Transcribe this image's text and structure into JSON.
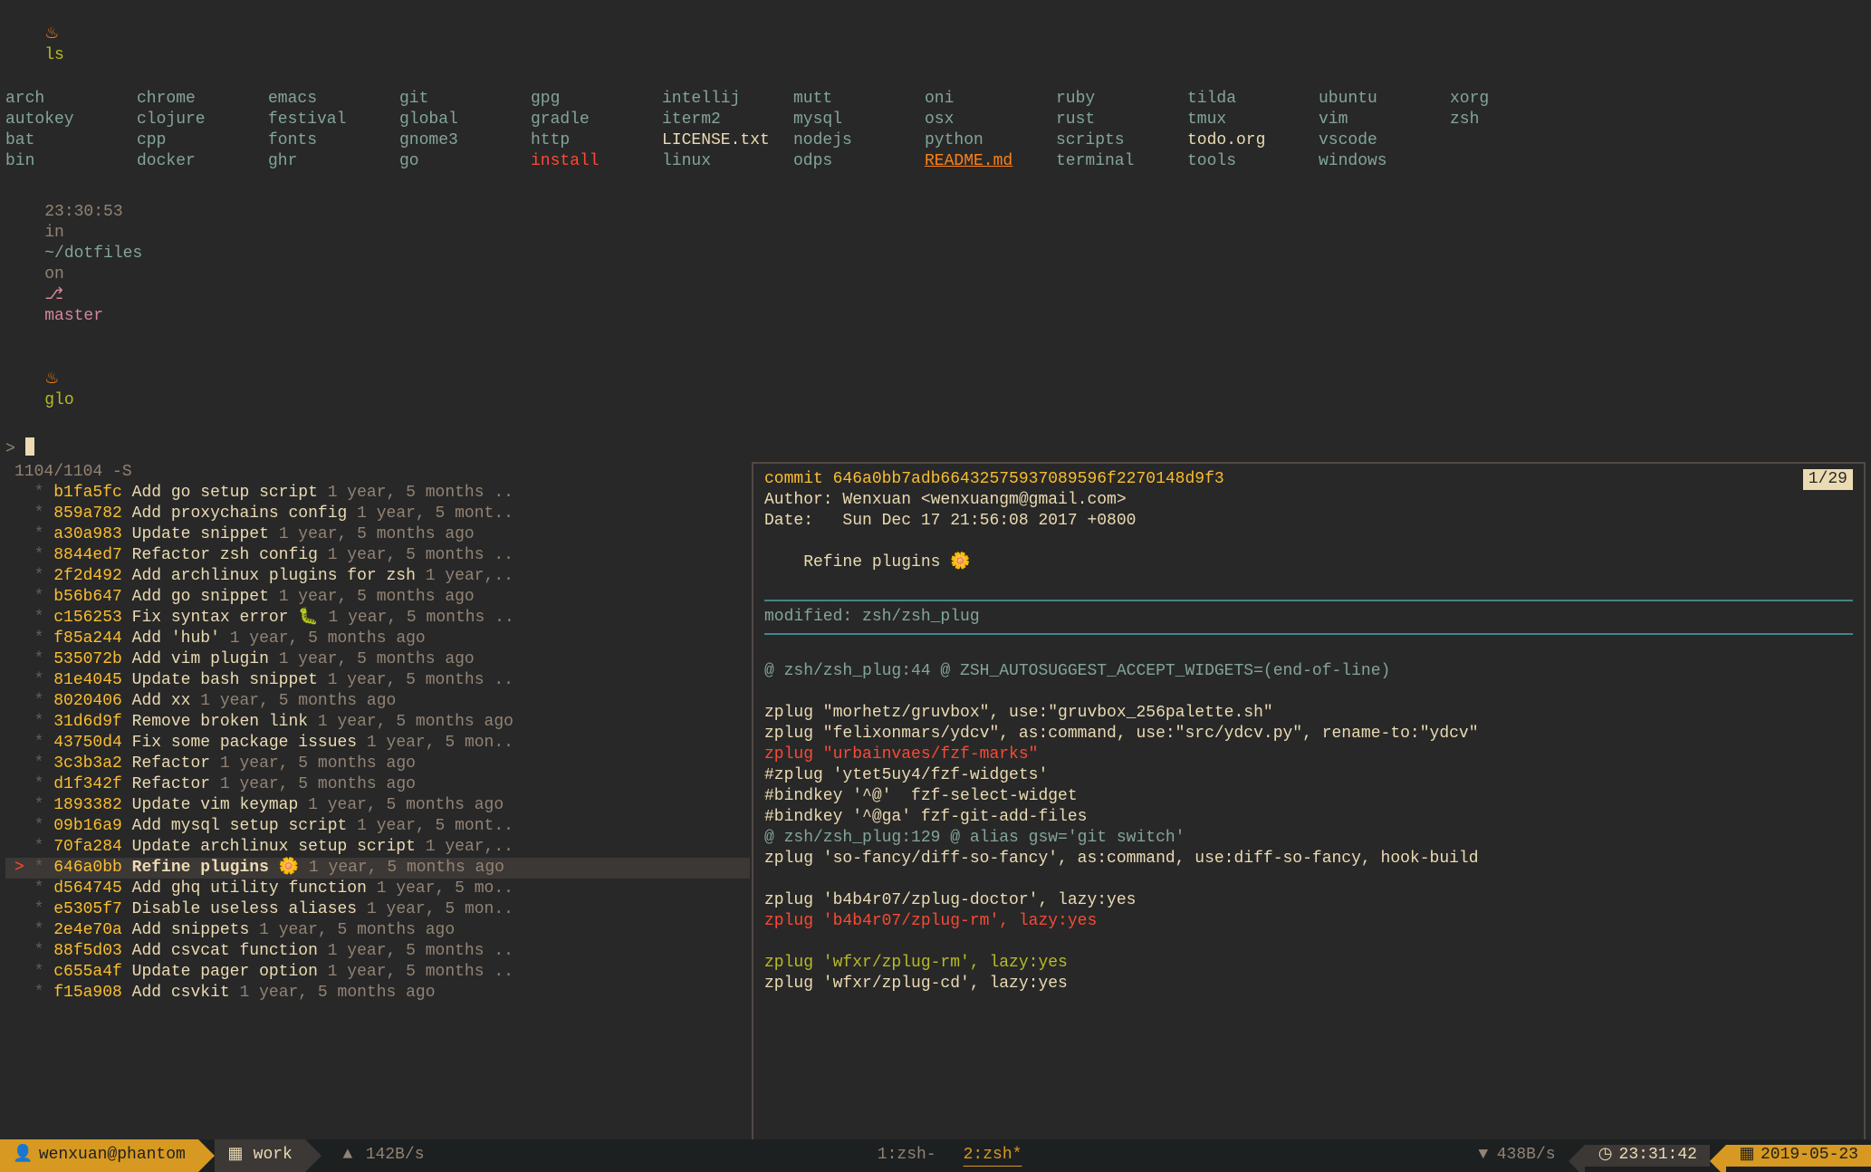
{
  "prompt1": {
    "flame": "♨",
    "cmd": "ls"
  },
  "ls": {
    "rows": [
      [
        {
          "t": "arch"
        },
        {
          "t": "chrome"
        },
        {
          "t": "emacs"
        },
        {
          "t": "git"
        },
        {
          "t": "gpg"
        },
        {
          "t": "intellij"
        },
        {
          "t": "mutt"
        },
        {
          "t": "oni"
        },
        {
          "t": "ruby"
        },
        {
          "t": "tilda"
        },
        {
          "t": "ubuntu"
        },
        {
          "t": "xorg"
        }
      ],
      [
        {
          "t": "autokey"
        },
        {
          "t": "clojure"
        },
        {
          "t": "festival"
        },
        {
          "t": "global"
        },
        {
          "t": "gradle"
        },
        {
          "t": "iterm2"
        },
        {
          "t": "mysql"
        },
        {
          "t": "osx"
        },
        {
          "t": "rust"
        },
        {
          "t": "tmux"
        },
        {
          "t": "vim"
        },
        {
          "t": "zsh"
        }
      ],
      [
        {
          "t": "bat"
        },
        {
          "t": "cpp"
        },
        {
          "t": "fonts"
        },
        {
          "t": "gnome3"
        },
        {
          "t": "http"
        },
        {
          "t": "LICENSE.txt",
          "cls": "file"
        },
        {
          "t": "nodejs"
        },
        {
          "t": "python"
        },
        {
          "t": "scripts"
        },
        {
          "t": "todo.org",
          "cls": "file"
        },
        {
          "t": "vscode"
        },
        {
          "t": ""
        }
      ],
      [
        {
          "t": "bin"
        },
        {
          "t": "docker"
        },
        {
          "t": "ghr"
        },
        {
          "t": "go"
        },
        {
          "t": "install",
          "cls": "exec"
        },
        {
          "t": "linux"
        },
        {
          "t": "odps"
        },
        {
          "t": "README.md",
          "cls": "link"
        },
        {
          "t": "terminal"
        },
        {
          "t": "tools"
        },
        {
          "t": "windows"
        },
        {
          "t": ""
        }
      ]
    ]
  },
  "prompt2": {
    "time": "23:30:53",
    "in": "in",
    "path": "~/dotfiles",
    "on": "on",
    "branch_icon": "⎇",
    "branch": "master",
    "flame": "♨",
    "cmd": "glo"
  },
  "fzf": {
    "query_prefix": ">",
    "counter": "1104/1104 -S",
    "commits": [
      {
        "hash": "b1fa5fc",
        "msg": "Add go setup script",
        "age": "1 year, 5 months .."
      },
      {
        "hash": "859a782",
        "msg": "Add proxychains config",
        "age": "1 year, 5 mont.."
      },
      {
        "hash": "a30a983",
        "msg": "Update snippet",
        "age": "1 year, 5 months ago"
      },
      {
        "hash": "8844ed7",
        "msg": "Refactor zsh config",
        "age": "1 year, 5 months .."
      },
      {
        "hash": "2f2d492",
        "msg": "Add archlinux plugins for zsh",
        "age": "1 year,.."
      },
      {
        "hash": "b56b647",
        "msg": "Add go snippet",
        "age": "1 year, 5 months ago"
      },
      {
        "hash": "c156253",
        "msg": "Fix syntax error 🐛",
        "age": "1 year, 5 months .."
      },
      {
        "hash": "f85a244",
        "msg": "Add 'hub'",
        "age": "1 year, 5 months ago"
      },
      {
        "hash": "535072b",
        "msg": "Add vim plugin",
        "age": "1 year, 5 months ago"
      },
      {
        "hash": "81e4045",
        "msg": "Update bash snippet",
        "age": "1 year, 5 months .."
      },
      {
        "hash": "8020406",
        "msg": "Add xx",
        "age": "1 year, 5 months ago"
      },
      {
        "hash": "31d6d9f",
        "msg": "Remove broken link",
        "age": "1 year, 5 months ago"
      },
      {
        "hash": "43750d4",
        "msg": "Fix some package issues",
        "age": "1 year, 5 mon.."
      },
      {
        "hash": "3c3b3a2",
        "msg": "Refactor",
        "age": "1 year, 5 months ago"
      },
      {
        "hash": "d1f342f",
        "msg": "Refactor",
        "age": "1 year, 5 months ago"
      },
      {
        "hash": "1893382",
        "msg": "Update vim keymap",
        "age": "1 year, 5 months ago"
      },
      {
        "hash": "09b16a9",
        "msg": "Add mysql setup script",
        "age": "1 year, 5 mont.."
      },
      {
        "hash": "70fa284",
        "msg": "Update archlinux setup script",
        "age": "1 year,.."
      },
      {
        "hash": "646a0bb",
        "msg": "Refine plugins 🌼",
        "age": "1 year, 5 months ago",
        "selected": true
      },
      {
        "hash": "d564745",
        "msg": "Add ghq utility function",
        "age": "1 year, 5 mo.."
      },
      {
        "hash": "e5305f7",
        "msg": "Disable useless aliases",
        "age": "1 year, 5 mon.."
      },
      {
        "hash": "2e4e70a",
        "msg": "Add snippets",
        "age": "1 year, 5 months ago"
      },
      {
        "hash": "88f5d03",
        "msg": "Add csvcat function",
        "age": "1 year, 5 months .."
      },
      {
        "hash": "c655a4f",
        "msg": "Update pager option",
        "age": "1 year, 5 months .."
      },
      {
        "hash": "f15a908",
        "msg": "Add csvkit",
        "age": "1 year, 5 months ago"
      }
    ]
  },
  "preview": {
    "counter": "1/29",
    "commit_line": "commit 646a0bb7adb66432575937089596f2270148d9f3",
    "author": "Author: Wenxuan <wenxuangm@gmail.com>",
    "date": "Date:   Sun Dec 17 21:56:08 2017 +0800",
    "title": "    Refine plugins 🌼",
    "modified": "modified: zsh/zsh_plug",
    "hunk1": "@ zsh/zsh_plug:44 @ ZSH_AUTOSUGGEST_ACCEPT_WIDGETS=(end-of-line)",
    "ctx": [
      "zplug \"morhetz/gruvbox\", use:\"gruvbox_256palette.sh\"",
      "zplug \"felixonmars/ydcv\", as:command, use:\"src/ydcv.py\", rename-to:\"ydcv\""
    ],
    "del1": "zplug \"urbainvaes/fzf-marks\"",
    "ctx2": [
      "#zplug 'ytet5uy4/fzf-widgets'",
      "#bindkey '^@'  fzf-select-widget",
      "#bindkey '^@ga' fzf-git-add-files"
    ],
    "hunk2": "@ zsh/zsh_plug:129 @ alias gsw='git switch'",
    "ctx3": "zplug 'so-fancy/diff-so-fancy', as:command, use:diff-so-fancy, hook-build",
    "ctx4": "zplug 'b4b4r07/zplug-doctor', lazy:yes",
    "del2": "zplug 'b4b4r07/zplug-rm', lazy:yes",
    "add1": "zplug 'wfxr/zplug-rm', lazy:yes",
    "ctx5": "zplug 'wfxr/zplug-cd', lazy:yes"
  },
  "status": {
    "user": "wenxuan@phantom",
    "session_icon": "▦",
    "session": "work",
    "up_icon": "▲",
    "up": "142B/s",
    "tabs": [
      {
        "label": "1:zsh-"
      },
      {
        "label": "2:zsh*",
        "active": true
      }
    ],
    "down_icon": "▼",
    "down": "438B/s",
    "clock_icon": "◷",
    "clock": "23:31:42",
    "cal_icon": "▦",
    "date": "2019-05-23"
  }
}
